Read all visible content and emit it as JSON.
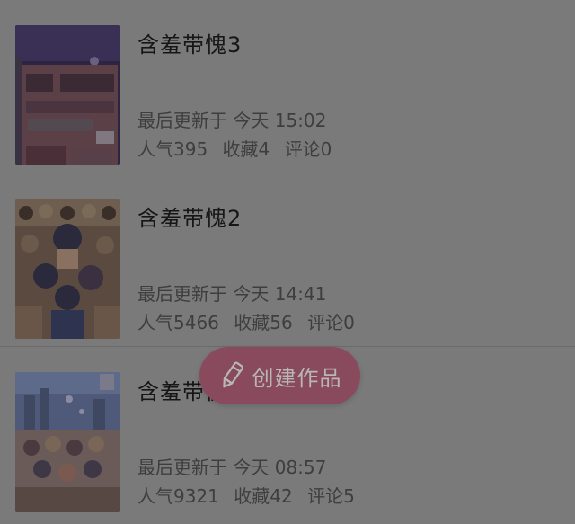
{
  "works": [
    {
      "title": "含羞带愧3",
      "updated": "最后更新于 今天 15:02",
      "stats": {
        "popularity": "人气395",
        "favorites": "收藏4",
        "comments": "评论0"
      }
    },
    {
      "title": "含羞带愧2",
      "updated": "最后更新于 今天 14:41",
      "stats": {
        "popularity": "人气5466",
        "favorites": "收藏56",
        "comments": "评论0"
      }
    },
    {
      "title": "含羞带愧",
      "updated": "最后更新于 今天 08:57",
      "stats": {
        "popularity": "人气9321",
        "favorites": "收藏42",
        "comments": "评论5"
      }
    }
  ],
  "create_button": {
    "label": "创建作品",
    "icon": "pencil-icon",
    "color": "#8a4a5e"
  },
  "colors": {
    "overlay_background": "#7a7a7a",
    "title_text": "#161616",
    "meta_text": "#3e3e3e"
  }
}
